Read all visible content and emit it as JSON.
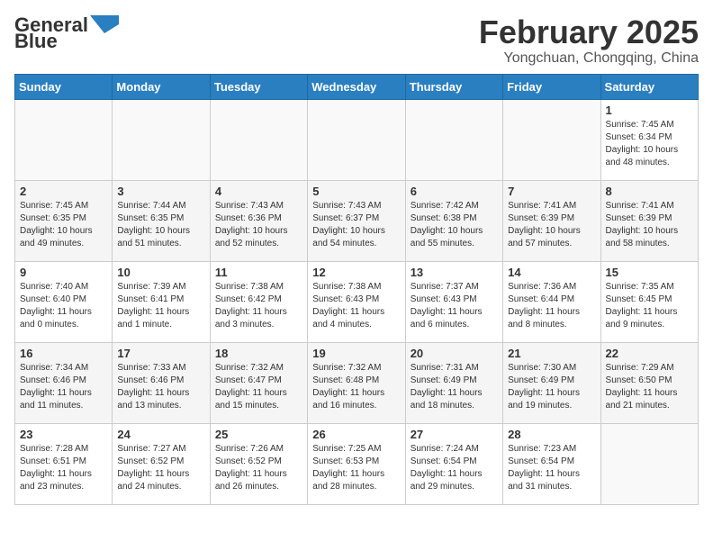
{
  "header": {
    "logo_general": "General",
    "logo_blue": "Blue",
    "title": "February 2025",
    "subtitle": "Yongchuan, Chongqing, China"
  },
  "weekdays": [
    "Sunday",
    "Monday",
    "Tuesday",
    "Wednesday",
    "Thursday",
    "Friday",
    "Saturday"
  ],
  "weeks": [
    [
      {
        "day": "",
        "info": ""
      },
      {
        "day": "",
        "info": ""
      },
      {
        "day": "",
        "info": ""
      },
      {
        "day": "",
        "info": ""
      },
      {
        "day": "",
        "info": ""
      },
      {
        "day": "",
        "info": ""
      },
      {
        "day": "1",
        "info": "Sunrise: 7:45 AM\nSunset: 6:34 PM\nDaylight: 10 hours\nand 48 minutes."
      }
    ],
    [
      {
        "day": "2",
        "info": "Sunrise: 7:45 AM\nSunset: 6:35 PM\nDaylight: 10 hours\nand 49 minutes."
      },
      {
        "day": "3",
        "info": "Sunrise: 7:44 AM\nSunset: 6:35 PM\nDaylight: 10 hours\nand 51 minutes."
      },
      {
        "day": "4",
        "info": "Sunrise: 7:43 AM\nSunset: 6:36 PM\nDaylight: 10 hours\nand 52 minutes."
      },
      {
        "day": "5",
        "info": "Sunrise: 7:43 AM\nSunset: 6:37 PM\nDaylight: 10 hours\nand 54 minutes."
      },
      {
        "day": "6",
        "info": "Sunrise: 7:42 AM\nSunset: 6:38 PM\nDaylight: 10 hours\nand 55 minutes."
      },
      {
        "day": "7",
        "info": "Sunrise: 7:41 AM\nSunset: 6:39 PM\nDaylight: 10 hours\nand 57 minutes."
      },
      {
        "day": "8",
        "info": "Sunrise: 7:41 AM\nSunset: 6:39 PM\nDaylight: 10 hours\nand 58 minutes."
      }
    ],
    [
      {
        "day": "9",
        "info": "Sunrise: 7:40 AM\nSunset: 6:40 PM\nDaylight: 11 hours\nand 0 minutes."
      },
      {
        "day": "10",
        "info": "Sunrise: 7:39 AM\nSunset: 6:41 PM\nDaylight: 11 hours\nand 1 minute."
      },
      {
        "day": "11",
        "info": "Sunrise: 7:38 AM\nSunset: 6:42 PM\nDaylight: 11 hours\nand 3 minutes."
      },
      {
        "day": "12",
        "info": "Sunrise: 7:38 AM\nSunset: 6:43 PM\nDaylight: 11 hours\nand 4 minutes."
      },
      {
        "day": "13",
        "info": "Sunrise: 7:37 AM\nSunset: 6:43 PM\nDaylight: 11 hours\nand 6 minutes."
      },
      {
        "day": "14",
        "info": "Sunrise: 7:36 AM\nSunset: 6:44 PM\nDaylight: 11 hours\nand 8 minutes."
      },
      {
        "day": "15",
        "info": "Sunrise: 7:35 AM\nSunset: 6:45 PM\nDaylight: 11 hours\nand 9 minutes."
      }
    ],
    [
      {
        "day": "16",
        "info": "Sunrise: 7:34 AM\nSunset: 6:46 PM\nDaylight: 11 hours\nand 11 minutes."
      },
      {
        "day": "17",
        "info": "Sunrise: 7:33 AM\nSunset: 6:46 PM\nDaylight: 11 hours\nand 13 minutes."
      },
      {
        "day": "18",
        "info": "Sunrise: 7:32 AM\nSunset: 6:47 PM\nDaylight: 11 hours\nand 15 minutes."
      },
      {
        "day": "19",
        "info": "Sunrise: 7:32 AM\nSunset: 6:48 PM\nDaylight: 11 hours\nand 16 minutes."
      },
      {
        "day": "20",
        "info": "Sunrise: 7:31 AM\nSunset: 6:49 PM\nDaylight: 11 hours\nand 18 minutes."
      },
      {
        "day": "21",
        "info": "Sunrise: 7:30 AM\nSunset: 6:49 PM\nDaylight: 11 hours\nand 19 minutes."
      },
      {
        "day": "22",
        "info": "Sunrise: 7:29 AM\nSunset: 6:50 PM\nDaylight: 11 hours\nand 21 minutes."
      }
    ],
    [
      {
        "day": "23",
        "info": "Sunrise: 7:28 AM\nSunset: 6:51 PM\nDaylight: 11 hours\nand 23 minutes."
      },
      {
        "day": "24",
        "info": "Sunrise: 7:27 AM\nSunset: 6:52 PM\nDaylight: 11 hours\nand 24 minutes."
      },
      {
        "day": "25",
        "info": "Sunrise: 7:26 AM\nSunset: 6:52 PM\nDaylight: 11 hours\nand 26 minutes."
      },
      {
        "day": "26",
        "info": "Sunrise: 7:25 AM\nSunset: 6:53 PM\nDaylight: 11 hours\nand 28 minutes."
      },
      {
        "day": "27",
        "info": "Sunrise: 7:24 AM\nSunset: 6:54 PM\nDaylight: 11 hours\nand 29 minutes."
      },
      {
        "day": "28",
        "info": "Sunrise: 7:23 AM\nSunset: 6:54 PM\nDaylight: 11 hours\nand 31 minutes."
      },
      {
        "day": "",
        "info": ""
      }
    ]
  ]
}
